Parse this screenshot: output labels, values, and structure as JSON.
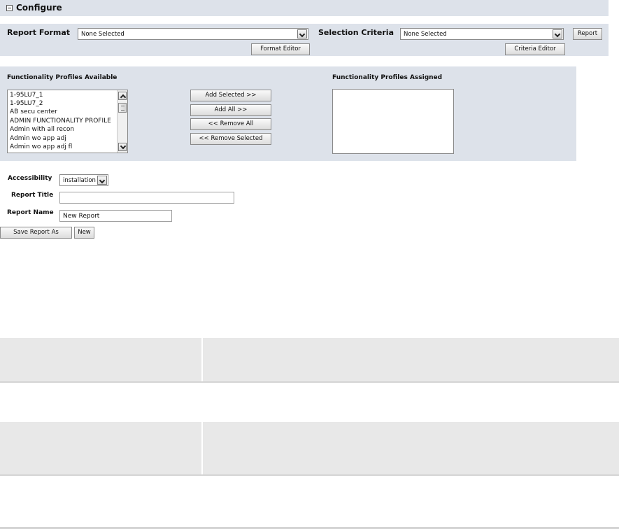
{
  "header": {
    "title": "Configure"
  },
  "report_row": {
    "format_label": "Report Format",
    "format_value": "None Selected",
    "format_editor_button": "Format Editor",
    "criteria_label": "Selection Criteria",
    "criteria_value": "None Selected",
    "criteria_editor_button": "Criteria Editor",
    "report_button": "Report"
  },
  "profiles": {
    "available_label": "Functionality Profiles Available",
    "assigned_label": "Functionality Profiles Assigned",
    "available_items": [
      "1-95LU7_1",
      "1-95LU7_2",
      "AB secu center",
      "ADMIN FUNCTIONALITY PROFILE",
      "Admin with all recon",
      "Admin wo app adj",
      "Admin wo app adj fl"
    ],
    "buttons": {
      "add_selected": "Add Selected >>",
      "add_all": "Add All >>",
      "remove_all": "<< Remove All",
      "remove_selected": "<< Remove Selected"
    }
  },
  "form": {
    "accessibility_label": "Accessibility",
    "accessibility_value": "installation",
    "report_title_label": "Report Title",
    "report_title_value": "",
    "report_name_label": "Report Name",
    "report_name_value": "New Report",
    "save_as_button": "Save Report As",
    "new_button": "New"
  }
}
